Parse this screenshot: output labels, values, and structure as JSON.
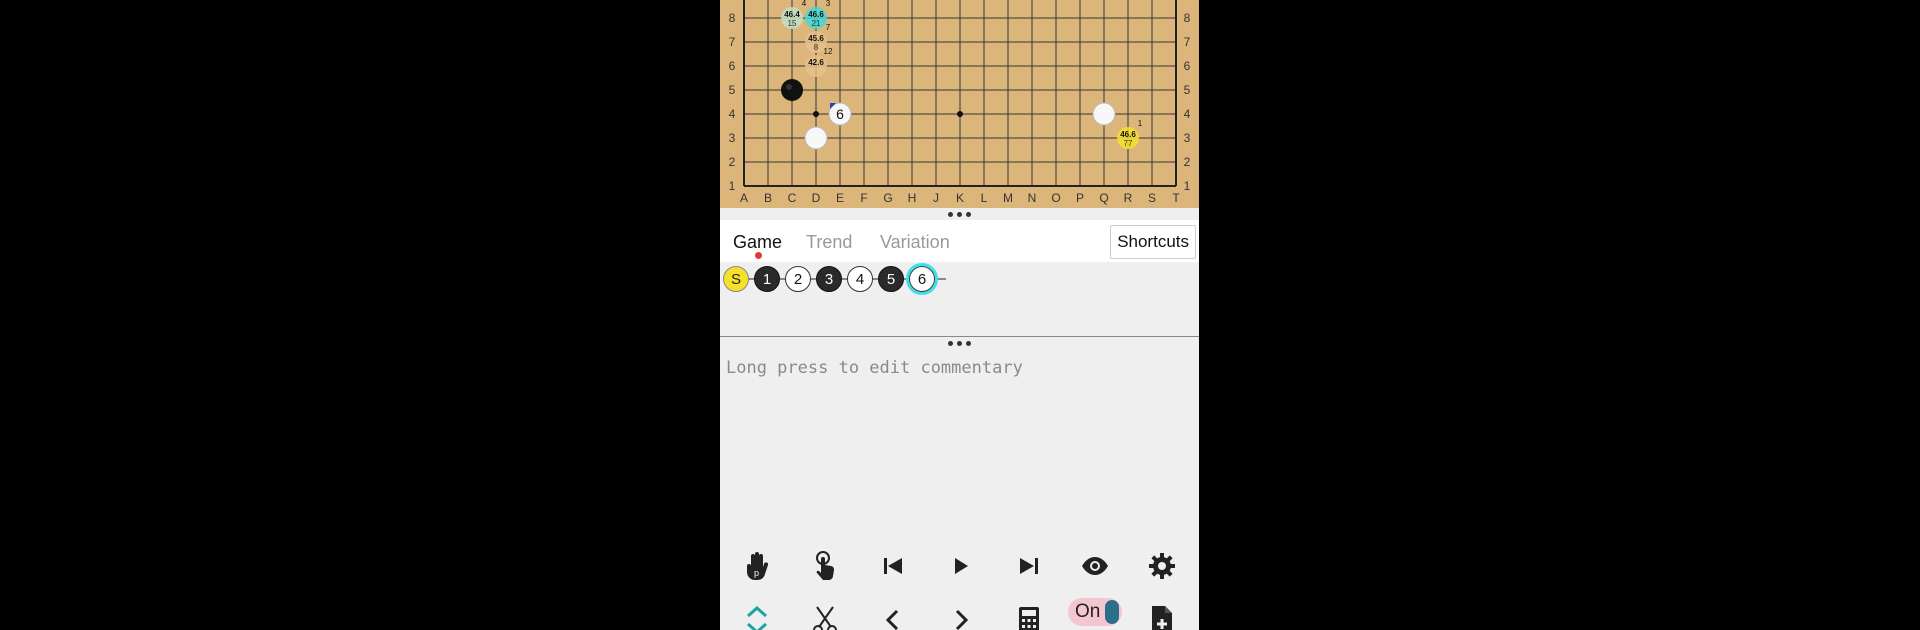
{
  "board": {
    "columns": [
      "A",
      "B",
      "C",
      "D",
      "E",
      "F",
      "G",
      "H",
      "J",
      "K",
      "L",
      "M",
      "N",
      "O",
      "P",
      "Q",
      "R",
      "S",
      "T"
    ],
    "rows_visible": [
      "8",
      "7",
      "6",
      "5",
      "4",
      "3",
      "2",
      "1"
    ],
    "stones": [
      {
        "color": "black",
        "point": "C5"
      },
      {
        "color": "white",
        "point": "D3"
      },
      {
        "color": "white",
        "point": "Q4"
      },
      {
        "color": "white",
        "point": "E4",
        "label": "6"
      }
    ],
    "candidates": [
      {
        "point": "C8",
        "winrate": "46.4",
        "visits": "15",
        "order": "4",
        "fill": "#bfe0c8"
      },
      {
        "point": "D8",
        "winrate": "46.6",
        "visits": "21",
        "order": "3",
        "fill": "#3fd9d9"
      },
      {
        "point": "D7",
        "winrate": "45.6",
        "visits": "8",
        "order": "7",
        "fill": "#e7c08a"
      },
      {
        "point": "D6",
        "winrate": "42.6",
        "visits": "",
        "order": "12",
        "fill": "#e7c08a"
      },
      {
        "point": "R3",
        "winrate": "46.6",
        "visits": "77",
        "order": "1",
        "fill": "#f4e22a"
      }
    ]
  },
  "tabs": {
    "game": "Game",
    "trend": "Trend",
    "variation": "Variation",
    "shortcuts": "Shortcuts"
  },
  "move_tree": {
    "nodes": [
      {
        "label": "S",
        "type": "s"
      },
      {
        "label": "1",
        "type": "b"
      },
      {
        "label": "2",
        "type": "w"
      },
      {
        "label": "3",
        "type": "b"
      },
      {
        "label": "4",
        "type": "w"
      },
      {
        "label": "5",
        "type": "b"
      },
      {
        "label": "6",
        "type": "w",
        "current": true
      }
    ]
  },
  "commentary": {
    "placeholder": "Long press to edit commentary"
  },
  "toolbar_top": [
    "hand-p-icon",
    "touch-hand-icon",
    "skip-first-icon",
    "play-icon",
    "skip-last-icon",
    "eye-icon",
    "gear-icon"
  ],
  "toolbar_bottom": {
    "icons": [
      "collapse-expand-icon",
      "scissors-icon",
      "chevron-left-icon",
      "chevron-right-icon",
      "calculator-icon",
      "toggle",
      "file-add-icon"
    ],
    "toggle_label": "On"
  }
}
